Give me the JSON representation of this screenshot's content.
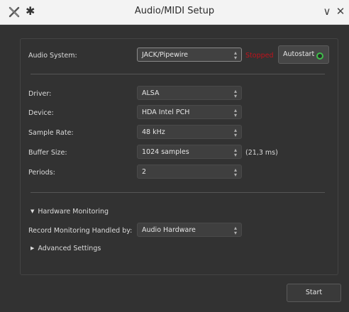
{
  "window": {
    "title": "Audio/MIDI Setup",
    "minimize": "∨",
    "close": "✕",
    "pin": "✱"
  },
  "audio_system": {
    "label": "Audio System:",
    "value": "JACK/Pipewire",
    "status": "Stopped",
    "autostart_label": "Autostart",
    "autostart_led_color": "#3fbf4a"
  },
  "settings": {
    "driver_label": "Driver:",
    "driver_value": "ALSA",
    "device_label": "Device:",
    "device_value": "HDA Intel PCH",
    "sample_rate_label": "Sample Rate:",
    "sample_rate_value": "48 kHz",
    "buffer_size_label": "Buffer Size:",
    "buffer_size_value": "1024 samples",
    "buffer_latency": "(21,3 ms)",
    "periods_label": "Periods:",
    "periods_value": "2"
  },
  "hardware_monitoring": {
    "title": "Hardware Monitoring",
    "record_label": "Record Monitoring Handled by:",
    "record_value": "Audio Hardware"
  },
  "advanced": {
    "title": "Advanced Settings"
  },
  "footer": {
    "start_label": "Start"
  },
  "colors": {
    "background": "#323232",
    "status_stopped": "#c1121c",
    "titlebar": "#f3f3f3"
  }
}
